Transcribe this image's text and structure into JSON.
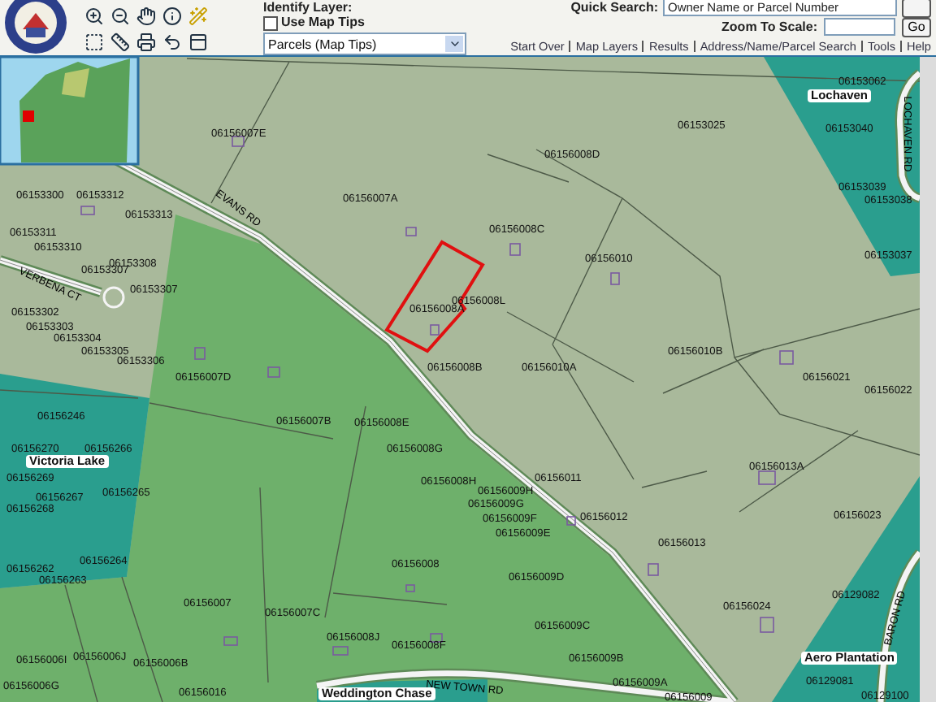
{
  "header": {
    "identify_layer_label": "Identify Layer:",
    "use_map_tips": {
      "label": "Use Map Tips",
      "checked": false
    },
    "layer_select": "Parcels (Map Tips)",
    "quick_search_label": "Quick Search:",
    "quick_search_value": "Owner Name or Parcel Number",
    "zoom_label": "Zoom To Scale:",
    "go_button": "Go",
    "links": [
      "Start Over",
      "Map Layers",
      "Results",
      "Address/Name/Parcel Search",
      "Tools",
      "Help"
    ]
  },
  "map": {
    "subdivisions": [
      "Lochaven",
      "Victoria Lake",
      "Aero Plantation",
      "Weddington Chase"
    ],
    "streets": [
      "EVANS RD",
      "VERBENA CT",
      "LOCHAVEN RD",
      "BARON RD",
      "NEW TOWN RD"
    ],
    "parcels": [
      "06153062",
      "06156007E",
      "06153025",
      "06153040",
      "06156008D",
      "06153039",
      "06153300",
      "06153312",
      "06156007A",
      "06153038",
      "06153313",
      "06153311",
      "06156008C",
      "06153310",
      "06153308",
      "06156010",
      "06153037",
      "06153307",
      "06153307",
      "06156008A",
      "06156008L",
      "06153302",
      "06153303",
      "06153304",
      "06153305",
      "06156010B",
      "06153306",
      "06156008B",
      "06156010A",
      "06156007D",
      "06156021",
      "06156022",
      "06156246",
      "06156007B",
      "06156008E",
      "06156270",
      "06156266",
      "06156008G",
      "06156013A",
      "06156269",
      "06156008H",
      "06156011",
      "06156267",
      "06156265",
      "06156009H",
      "06156268",
      "06156009G",
      "06156009F",
      "06156012",
      "06156023",
      "06156009E",
      "06156013",
      "06156262",
      "06156264",
      "06156008",
      "06156263",
      "06156009D",
      "06129082",
      "06156007",
      "06156007C",
      "06156024",
      "06156009C",
      "06156008J",
      "06156008F",
      "06156006I",
      "06156006J",
      "06156006B",
      "06156009B",
      "06156006G",
      "06156009A",
      "06129081",
      "06156016",
      "06156009",
      "06129100"
    ]
  }
}
